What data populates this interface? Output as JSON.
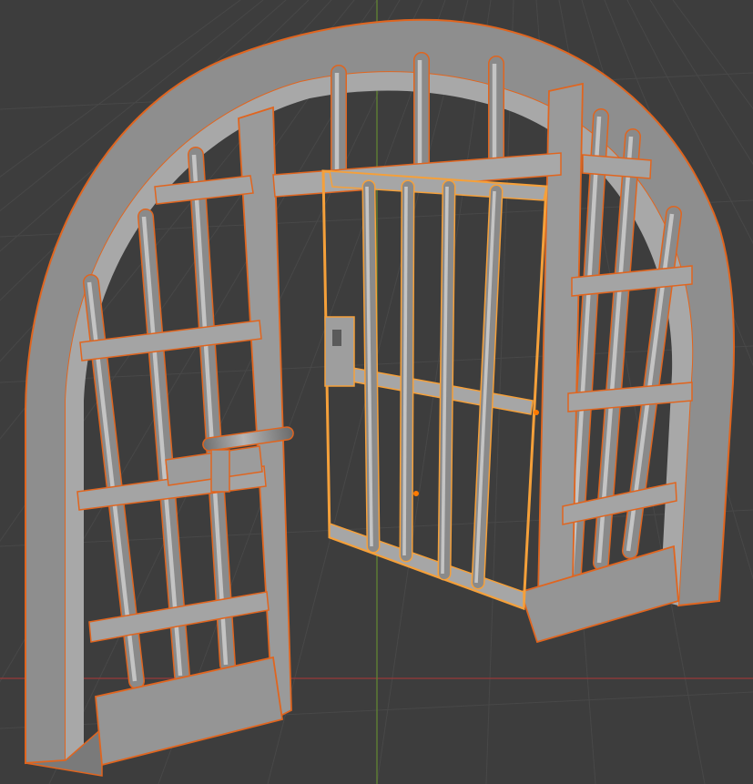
{
  "viewport": {
    "background": "#3d3d3d",
    "grid_color": "#484848",
    "axis_x_color": "#8a3a3a",
    "axis_y_color": "#5f7f33",
    "view": "user-perspective",
    "mode": "object-mode"
  },
  "scene": {
    "object": "prison-gate-model",
    "parts": [
      "arch-frame",
      "left-grille",
      "right-grille",
      "open-door",
      "latch-bolt",
      "padlock-plate"
    ],
    "selected": "open-door",
    "active": "prison-gate-model",
    "material_color": "#8f8f8f",
    "selection_outline": "#e0651f",
    "active_outline": "#f5a03a",
    "origin_color": "#ff7a00"
  }
}
